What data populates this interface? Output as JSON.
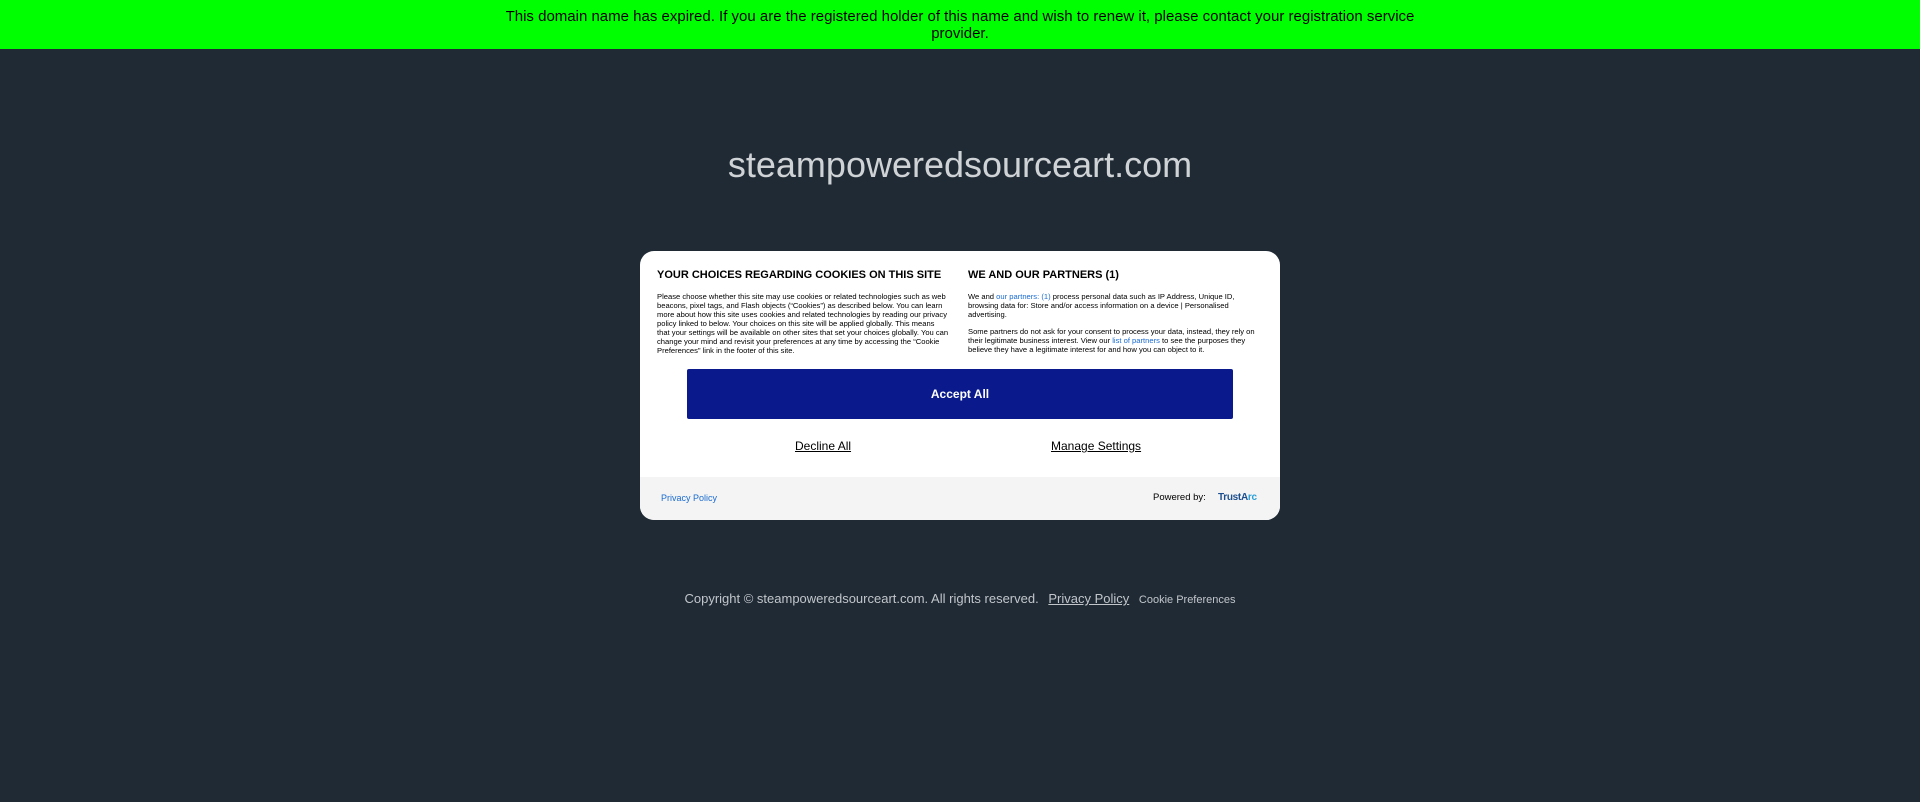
{
  "banner": {
    "text": "This domain name has expired. If you are the registered holder of this name and wish to renew it, please contact your registration service provider."
  },
  "page": {
    "domain_title": "steampoweredsourceart.com"
  },
  "cookie_modal": {
    "left_heading": "YOUR CHOICES REGARDING COOKIES ON THIS SITE",
    "left_body": "Please choose whether this site may use cookies or related technologies such as web beacons, pixel tags, and Flash objects (“Cookies”) as described below. You can learn more about how this site uses cookies and related technologies by reading our privacy policy linked to below. Your choices on this site will be applied globally. This means that your settings will be available on other sites that set your choices globally. You can change your mind and revisit your preferences at any time by accessing the “Cookie Preferences” link in the footer of this site.",
    "right_heading": "WE AND OUR PARTNERS (1)",
    "right_p1_before": "We and ",
    "right_p1_link": "our partners: (1)",
    "right_p1_after": " process personal data such as IP Address, Unique ID, browsing data for: Store and/or access information on a device | Personalised advertising.",
    "right_p2_before": "Some partners do not ask for your consent to process your data, instead, they rely on their legitimate business interest. View our ",
    "right_p2_link": "list of partners",
    "right_p2_after": " to see the purposes they believe they have a legitimate interest for and how you can object to it.",
    "accept_label": "Accept All",
    "decline_label": "Decline All",
    "manage_label": "Manage Settings",
    "footer_privacy": "Privacy Policy",
    "footer_powered": "Powered by:",
    "footer_logo_main": "TrustA",
    "footer_logo_accent": "rc",
    "colors": {
      "accept_bg": "#0a1a8c",
      "link": "#1a6bd1"
    }
  },
  "footer": {
    "copyright": "Copyright © steampoweredsourceart.com.  All rights reserved.",
    "privacy_policy": "Privacy Policy",
    "cookie_preferences": "Cookie Preferences"
  },
  "colors": {
    "banner_bg": "#00ff00",
    "page_bg": "#1f2a35"
  }
}
